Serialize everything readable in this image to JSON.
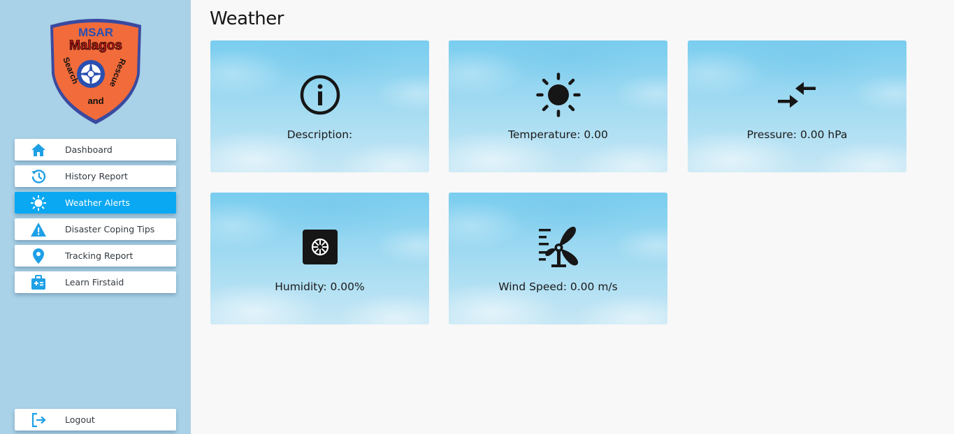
{
  "sidebar": {
    "logo": {
      "top_text": "MSAR",
      "name_text": "Malagos",
      "left_text": "Search",
      "right_text": "Rescue",
      "bottom_text": "and",
      "colors": {
        "shield_fill": "#f26b3a",
        "shield_border": "#3a4aa0",
        "emblem": "#2a4fb0"
      }
    },
    "items": [
      {
        "label": "Dashboard",
        "icon": "home-icon",
        "active": false
      },
      {
        "label": "History Report",
        "icon": "history-icon",
        "active": false
      },
      {
        "label": "Weather Alerts",
        "icon": "sun-icon",
        "active": true
      },
      {
        "label": "Disaster Coping Tips",
        "icon": "warning-icon",
        "active": false
      },
      {
        "label": "Tracking Report",
        "icon": "location-pin-icon",
        "active": false
      },
      {
        "label": "Learn Firstaid",
        "icon": "first-aid-icon",
        "active": false
      }
    ],
    "logout": {
      "label": "Logout",
      "icon": "logout-icon"
    }
  },
  "main": {
    "title": "Weather",
    "cards": [
      {
        "label": "Description:",
        "icon": "info-icon"
      },
      {
        "label": "Temperature: 0.00",
        "icon": "sun-icon"
      },
      {
        "label": "Pressure: 0.00 hPa",
        "icon": "compress-arrows-icon"
      },
      {
        "label": "Humidity: 0.00%",
        "icon": "humidifier-icon"
      },
      {
        "label": "Wind Speed: 0.00 m/s",
        "icon": "wind-fan-icon"
      }
    ]
  },
  "colors": {
    "sidebar_bg": "#a9d1e7",
    "active_item": "#0aa8f2",
    "nav_icon": "#1ea0e6",
    "page_bg": "#f8f8f8"
  }
}
